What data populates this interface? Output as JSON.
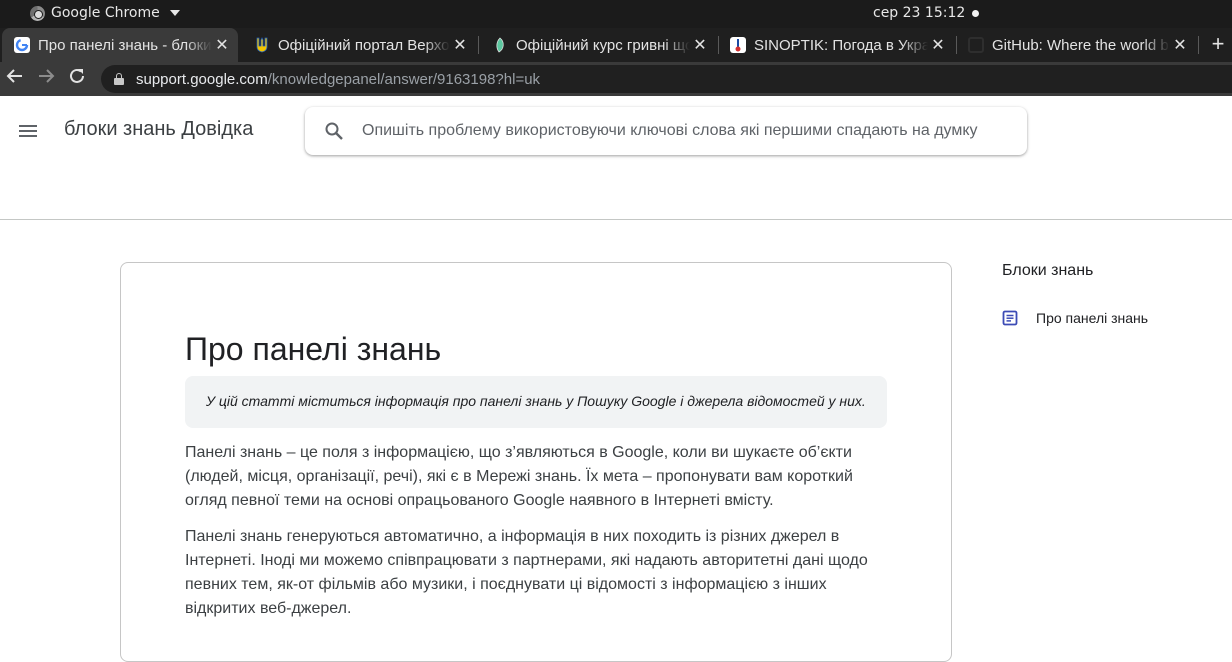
{
  "os": {
    "app_name": "Google Chrome",
    "clock": "сер 23  15:12"
  },
  "tabs": [
    {
      "title": "Про панелі знань - блоки знань Довідка",
      "favicon": "google-icon",
      "active": true
    },
    {
      "title": "Офіційний портал Верховної Ради України",
      "favicon": "trident-icon",
      "active": false
    },
    {
      "title": "Офіційний курс гривні щодо іноземних валют",
      "favicon": "leaf-icon",
      "active": false
    },
    {
      "title": "SINOPTIK: Погода в Україні",
      "favicon": "thermometer-icon",
      "active": false
    },
    {
      "title": "GitHub: Where the world builds software",
      "favicon": "github-icon",
      "active": false
    }
  ],
  "address": {
    "host": "support.google.com",
    "path": "/knowledgepanel/answer/9163198?hl=uk"
  },
  "header": {
    "product_title": "блоки знань Довідка",
    "search_placeholder": "Опишіть проблему використовуючи ключові слова які першими спадають на думку"
  },
  "article": {
    "title": "Про панелі знань",
    "summary": "У цій статті міститься інформація про панелі знань у Пошуку Google і джерела відомостей у них.",
    "paragraphs": [
      "Панелі знань – це поля з інформацією, що з’являються в Google, коли ви шукаєте об’єкти (людей, місця, організації, речі), які є в Мережі знань. Їх мета – пропонувати вам короткий огляд певної теми на основі опрацьованого Google наявного в Інтернеті вмісту.",
      "Панелі знань генеруються автоматично, а інформація в них походить із різних джерел в Інтернеті. Іноді ми можемо співпрацювати з партнерами, які надають авторитетні дані щодо певних тем, як-от фільмів або музики, і поєднувати ці відомості з інформацією з інших відкритих веб-джерел."
    ]
  },
  "sidebar": {
    "heading": "Блоки знань",
    "items": [
      {
        "label": "Про панелі знань",
        "icon": "document-icon"
      }
    ]
  },
  "colors": {
    "accent": "#1a73e8",
    "doc_icon": "#3c4bb5"
  }
}
